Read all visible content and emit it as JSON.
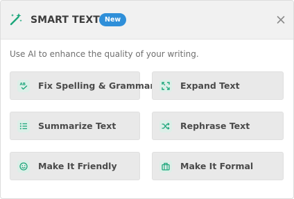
{
  "header": {
    "title": "SMART TEXT",
    "badge": "New",
    "title_icon": "magic-wand-icon",
    "close_icon": "close-icon"
  },
  "subtitle": "Use AI to enhance the quality of your writing.",
  "actions": [
    {
      "label": "Fix Spelling & Grammar",
      "icon": "spell-check-icon"
    },
    {
      "label": "Expand Text",
      "icon": "expand-icon"
    },
    {
      "label": "Summarize Text",
      "icon": "list-icon"
    },
    {
      "label": "Rephrase Text",
      "icon": "shuffle-icon"
    },
    {
      "label": "Make It Friendly",
      "icon": "smiley-icon"
    },
    {
      "label": "Make It Formal",
      "icon": "briefcase-icon"
    }
  ],
  "colors": {
    "accent": "#1aa67a",
    "badge": "#2f8fd9",
    "header_bg": "#f1f1f1",
    "button_bg": "#e9e9e9"
  }
}
